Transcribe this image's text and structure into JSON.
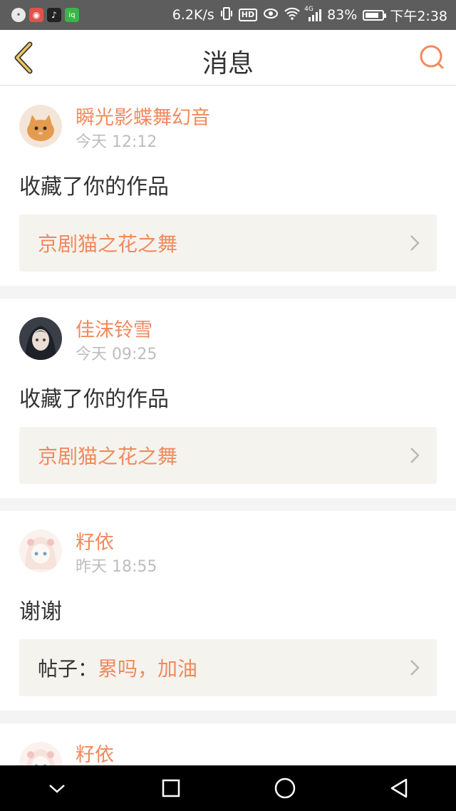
{
  "status_bar": {
    "speed": "6.2K/s",
    "hd": "HD",
    "network": "4G",
    "battery_percent": "83%",
    "battery_level": 0.83,
    "time": "下午2:38",
    "app_icons": [
      "wechat-icon",
      "app-red-icon",
      "tiktok-icon",
      "iqiyi-icon"
    ]
  },
  "header": {
    "title": "消息"
  },
  "notifications": [
    {
      "username": "瞬光影蝶舞幻音",
      "time": "今天 12:12",
      "action": "收藏了你的作品",
      "ref_prefix": "",
      "ref_title": "京剧猫之花之舞",
      "avatar": "avatar-cat"
    },
    {
      "username": "佳沫铃雪",
      "time": "今天 09:25",
      "action": "收藏了你的作品",
      "ref_prefix": "",
      "ref_title": "京剧猫之花之舞",
      "avatar": "avatar-girl-dark"
    },
    {
      "username": "籽依",
      "time": "昨天 18:55",
      "action": "谢谢",
      "ref_prefix": "帖子：",
      "ref_title": "累吗，加油",
      "avatar": "avatar-girl-light"
    },
    {
      "username": "籽依",
      "time": "",
      "action": "",
      "ref_prefix": "",
      "ref_title": "",
      "avatar": "avatar-girl-light"
    }
  ],
  "colors": {
    "accent": "#f08a5d",
    "back_icon": "#f0c75e"
  }
}
